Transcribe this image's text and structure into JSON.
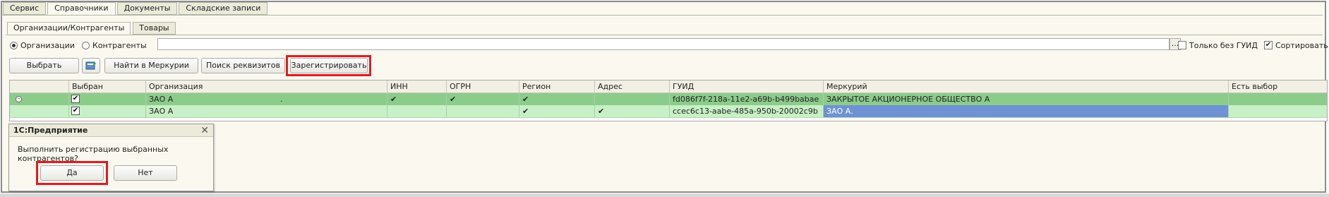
{
  "top_tabs": [
    "Сервис",
    "Справочники",
    "Документы",
    "Складские записи"
  ],
  "sub_tabs": [
    "Организации/Контрагенты",
    "Товары"
  ],
  "filter": {
    "radio_org": "Организации",
    "radio_contr": "Контрагенты",
    "search_value": "",
    "ellipsis": "...",
    "only_no_guid": "Только без ГУИД",
    "sort": "Сортировать"
  },
  "toolbar": {
    "select": "Выбрать",
    "find_mercury": "Найти в Меркурии",
    "find_details": "Поиск реквизитов",
    "register": "Зарегистрировать"
  },
  "grid": {
    "columns": [
      "",
      "Выбран",
      "Организация",
      "ИНН",
      "ОГРН",
      "Регион",
      "Адрес",
      "ГУИД",
      "Меркурий",
      "Есть выбор"
    ],
    "rows": [
      {
        "org": "ЗАО  А",
        "org_suffix": ".",
        "inn": "✔",
        "ogrn": "✔",
        "region": "✔",
        "address": "",
        "guid": "fd086f7f-218a-11e2-a69b-b499babae",
        "mercury": "ЗАКРЫТОЕ АКЦИОНЕРНОЕ ОБЩЕСТВО   А"
      },
      {
        "org": "ЗАО  А",
        "org_suffix": "",
        "inn": "",
        "ogrn": "",
        "region": "✔",
        "address": "✔",
        "guid": "ccec6c13-aabe-485a-950b-20002c9b",
        "mercury": "ЗАО  А."
      }
    ]
  },
  "dialog": {
    "title": "1С:Предприятие",
    "message": "Выполнить регистрацию выбранных контрагентов?",
    "yes": "Да",
    "no": "Нет"
  },
  "colors": {
    "highlight": "#e01b22",
    "row_selected": "#8ccc8b",
    "row_normal": "#c8f0c6",
    "cell_selected": "#6e92d4"
  }
}
